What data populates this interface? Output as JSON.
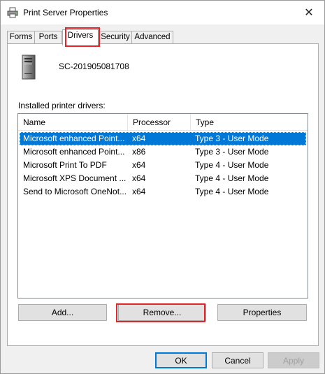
{
  "window": {
    "title": "Print Server Properties",
    "close_glyph": "✕"
  },
  "tabs": [
    {
      "label": "Forms"
    },
    {
      "label": "Ports"
    },
    {
      "label": "Drivers",
      "active": true
    },
    {
      "label": "Security"
    },
    {
      "label": "Advanced"
    }
  ],
  "server": {
    "name": "SC-201905081708"
  },
  "drivers": {
    "section_label": "Installed printer drivers:",
    "columns": [
      "Name",
      "Processor",
      "Type"
    ],
    "rows": [
      {
        "name": "Microsoft enhanced Point...",
        "processor": "x64",
        "type": "Type 3 - User Mode",
        "selected": true
      },
      {
        "name": "Microsoft enhanced Point...",
        "processor": "x86",
        "type": "Type 3 - User Mode"
      },
      {
        "name": "Microsoft Print To PDF",
        "processor": "x64",
        "type": "Type 4 - User Mode"
      },
      {
        "name": "Microsoft XPS Document ...",
        "processor": "x64",
        "type": "Type 4 - User Mode"
      },
      {
        "name": "Send to Microsoft OneNot...",
        "processor": "x64",
        "type": "Type 4 - User Mode"
      }
    ],
    "add_label": "Add...",
    "remove_label": "Remove...",
    "properties_label": "Properties"
  },
  "footer": {
    "ok_label": "OK",
    "cancel_label": "Cancel",
    "apply_label": "Apply"
  },
  "colors": {
    "selection": "#0078d7",
    "highlight_box": "#e0262b"
  }
}
